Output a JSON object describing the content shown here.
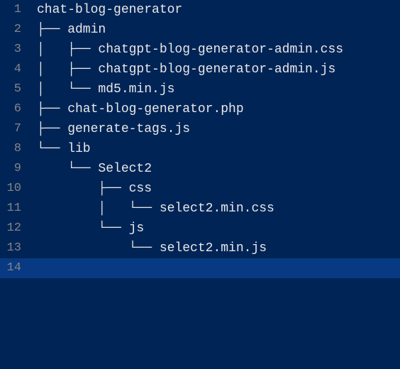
{
  "lines": [
    {
      "num": "1",
      "text": "chat-blog-generator",
      "highlighted": false
    },
    {
      "num": "2",
      "text": "├── admin",
      "highlighted": false
    },
    {
      "num": "3",
      "text": "│   ├── chatgpt-blog-generator-admin.css",
      "highlighted": false
    },
    {
      "num": "4",
      "text": "│   ├── chatgpt-blog-generator-admin.js",
      "highlighted": false
    },
    {
      "num": "5",
      "text": "│   └── md5.min.js",
      "highlighted": false
    },
    {
      "num": "6",
      "text": "├── chat-blog-generator.php",
      "highlighted": false
    },
    {
      "num": "7",
      "text": "├── generate-tags.js",
      "highlighted": false
    },
    {
      "num": "8",
      "text": "└── lib",
      "highlighted": false
    },
    {
      "num": "9",
      "text": "    └── Select2",
      "highlighted": false
    },
    {
      "num": "10",
      "text": "        ├── css",
      "highlighted": false
    },
    {
      "num": "11",
      "text": "        │   └── select2.min.css",
      "highlighted": false
    },
    {
      "num": "12",
      "text": "        └── js",
      "highlighted": false
    },
    {
      "num": "13",
      "text": "            └── select2.min.js",
      "highlighted": false
    },
    {
      "num": "14",
      "text": "",
      "highlighted": true
    }
  ]
}
